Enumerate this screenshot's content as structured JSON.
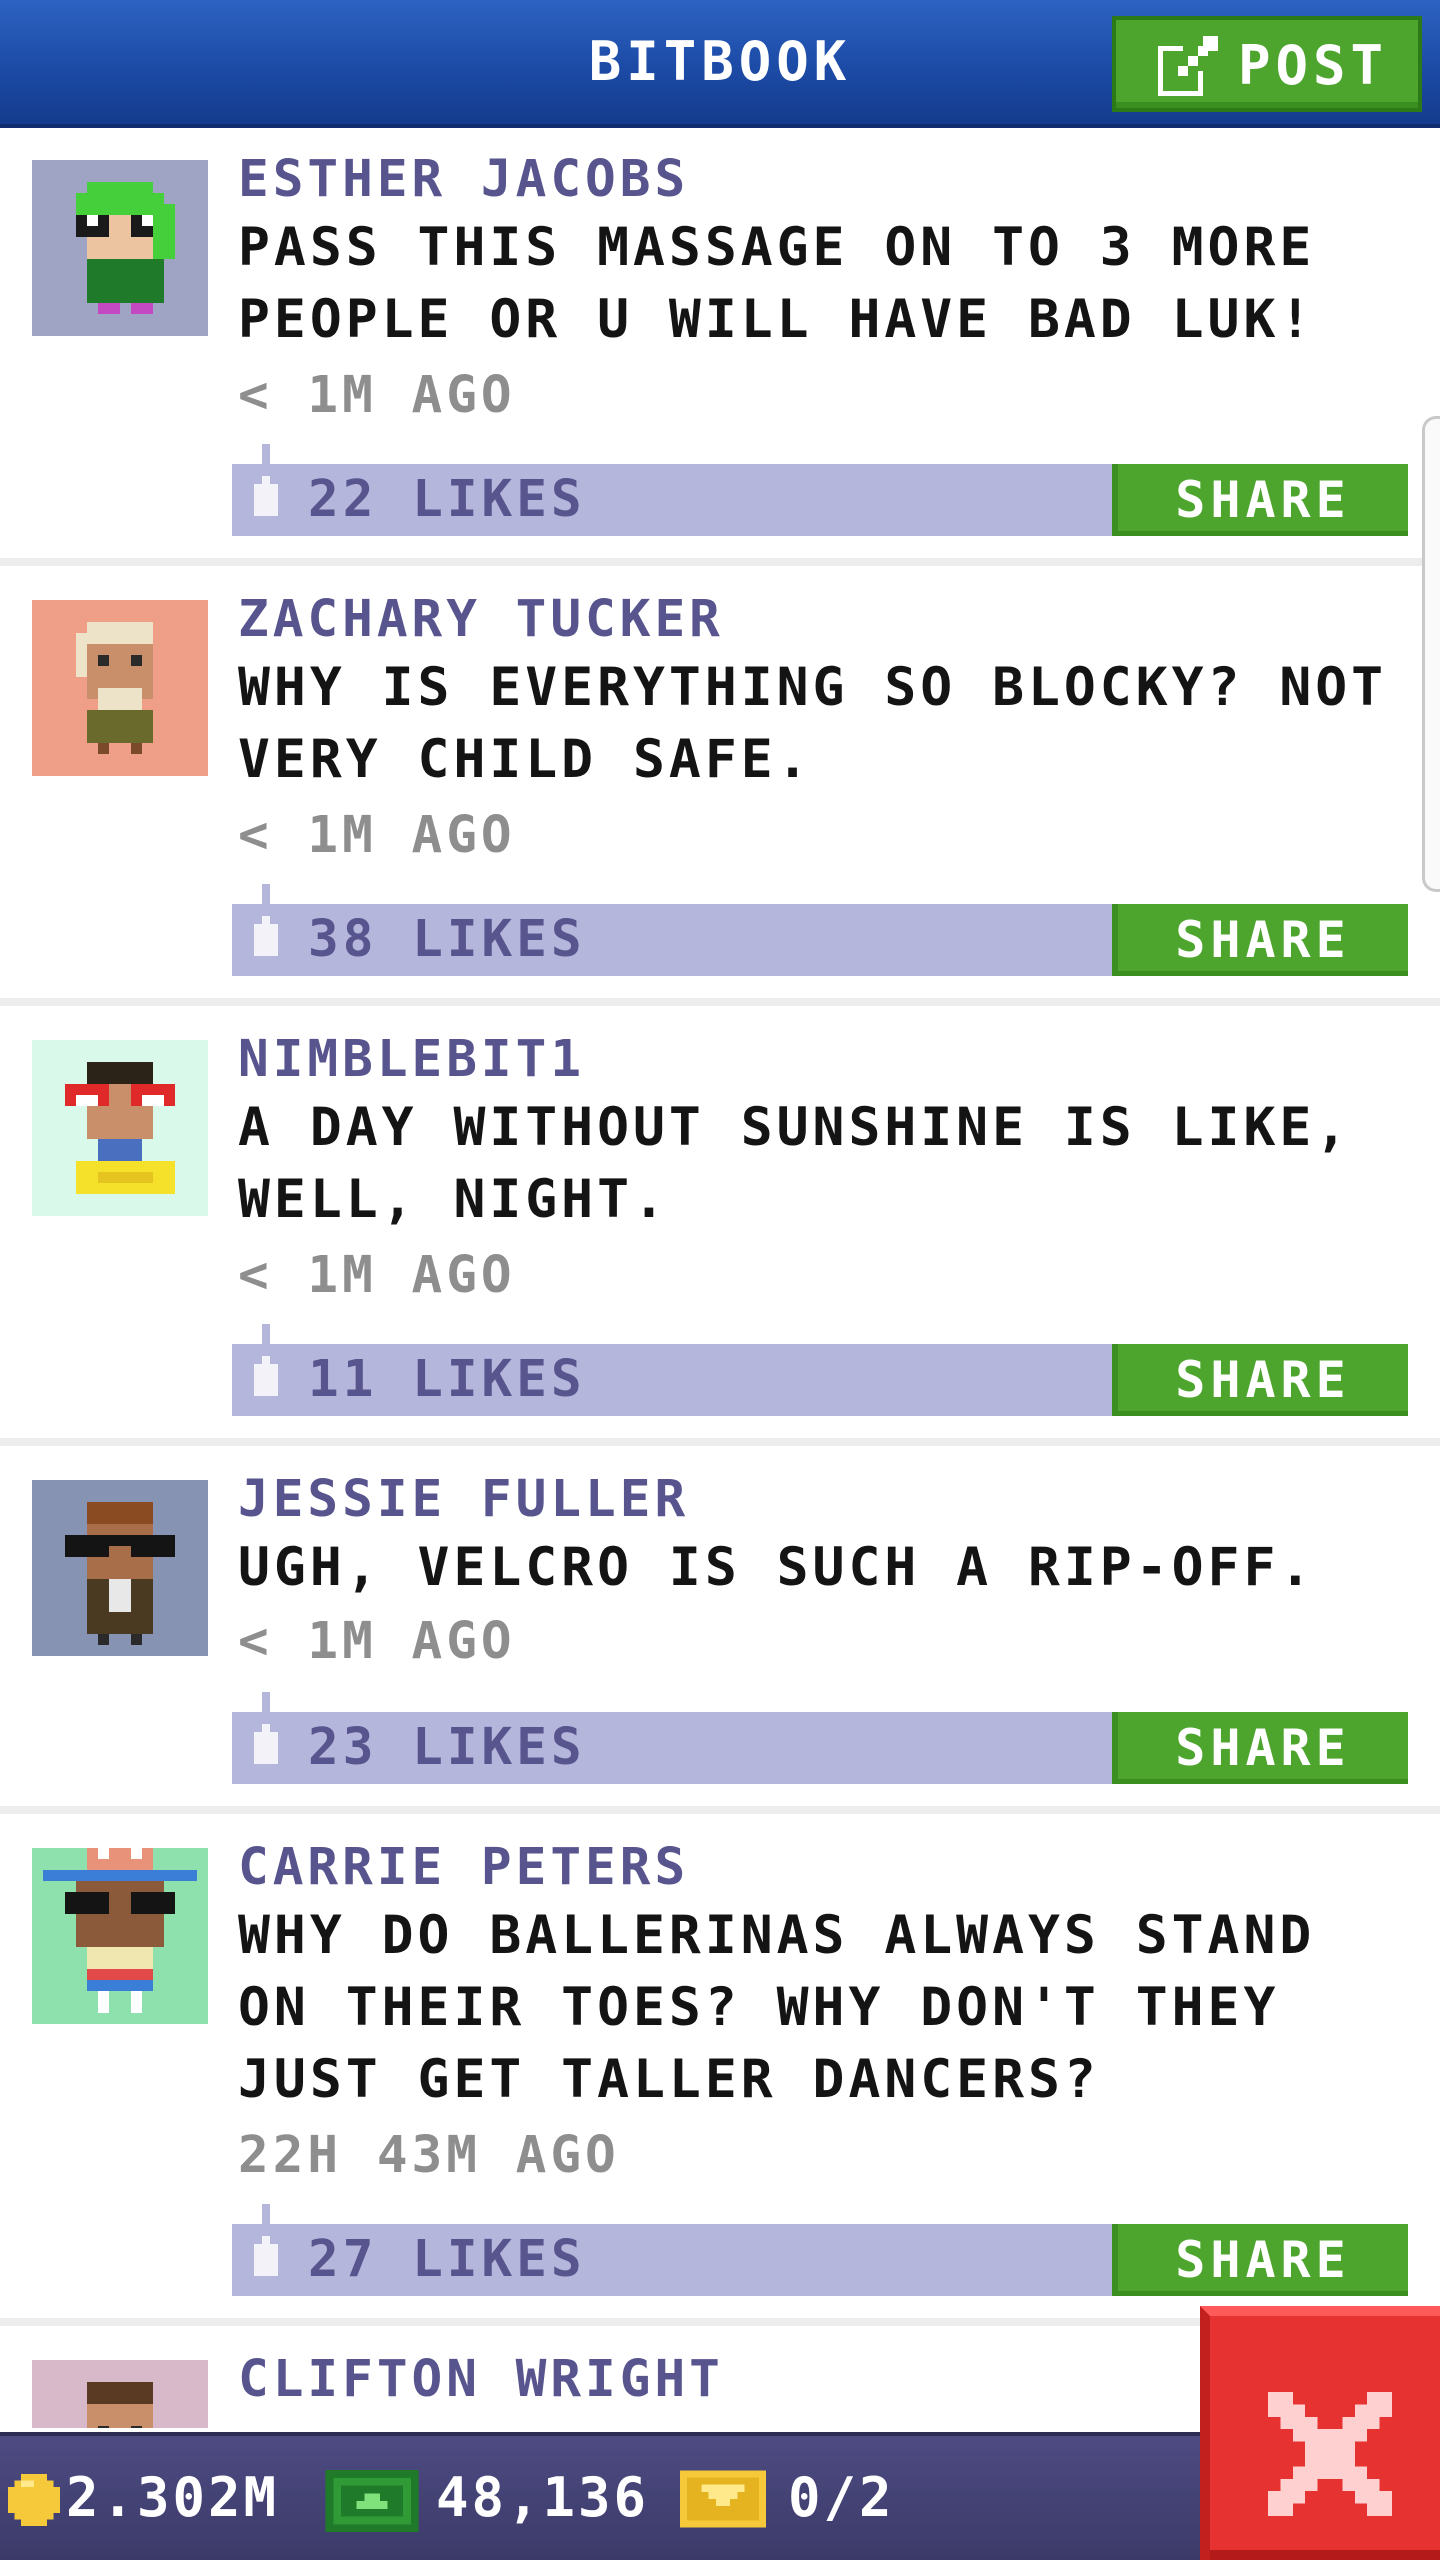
{
  "header": {
    "title": "BITBOOK",
    "post_label": "POST"
  },
  "posts": [
    {
      "author": "ESTHER JACOBS",
      "message_lines": [
        "PASS THIS MASSAGE ON TO 3 MORE",
        "PEOPLE OR U WILL HAVE BAD LUK!"
      ],
      "time": "< 1M AGO",
      "likes": "22 LIKES",
      "share": "SHARE",
      "avatar_bg": "#9fa3c4"
    },
    {
      "author": "ZACHARY TUCKER",
      "message_lines": [
        "WHY IS EVERYTHING SO BLOCKY? NOT",
        "VERY CHILD SAFE."
      ],
      "time": "< 1M AGO",
      "likes": "38 LIKES",
      "share": "SHARE",
      "avatar_bg": "#ef9f88"
    },
    {
      "author": "NIMBLEBIT1",
      "message_lines": [
        "A DAY WITHOUT SUNSHINE IS LIKE,",
        "WELL, NIGHT."
      ],
      "time": "< 1M AGO",
      "likes": "11 LIKES",
      "share": "SHARE",
      "avatar_bg": "#d9f9ea"
    },
    {
      "author": "JESSIE FULLER",
      "message_lines": [
        "UGH, VELCRO IS SUCH A RIP-OFF."
      ],
      "time": "< 1M AGO",
      "likes": "23 LIKES",
      "share": "SHARE",
      "avatar_bg": "#8793b2"
    },
    {
      "author": "CARRIE PETERS",
      "message_lines": [
        "WHY DO BALLERINAS ALWAYS STAND",
        "ON THEIR TOES? WHY DON'T THEY",
        "JUST GET TALLER DANCERS?"
      ],
      "time": "22H 43M AGO",
      "likes": "27 LIKES",
      "share": "SHARE",
      "avatar_bg": "#8ee1ad"
    },
    {
      "author": "CLIFTON WRIGHT",
      "avatar_bg": "#d8b9c9"
    }
  ],
  "status": {
    "coins": "2.302M",
    "bux": "48,136",
    "tickets": "0/2"
  },
  "colors": {
    "header": "#1c4ba6",
    "accent_green": "#4da52d",
    "like_bar": "#b5b6dc",
    "close_red": "#e73232"
  },
  "icons": [
    "edit-icon",
    "thumbs-up-icon",
    "coin-icon",
    "bux-icon",
    "ticket-icon",
    "close-icon"
  ]
}
